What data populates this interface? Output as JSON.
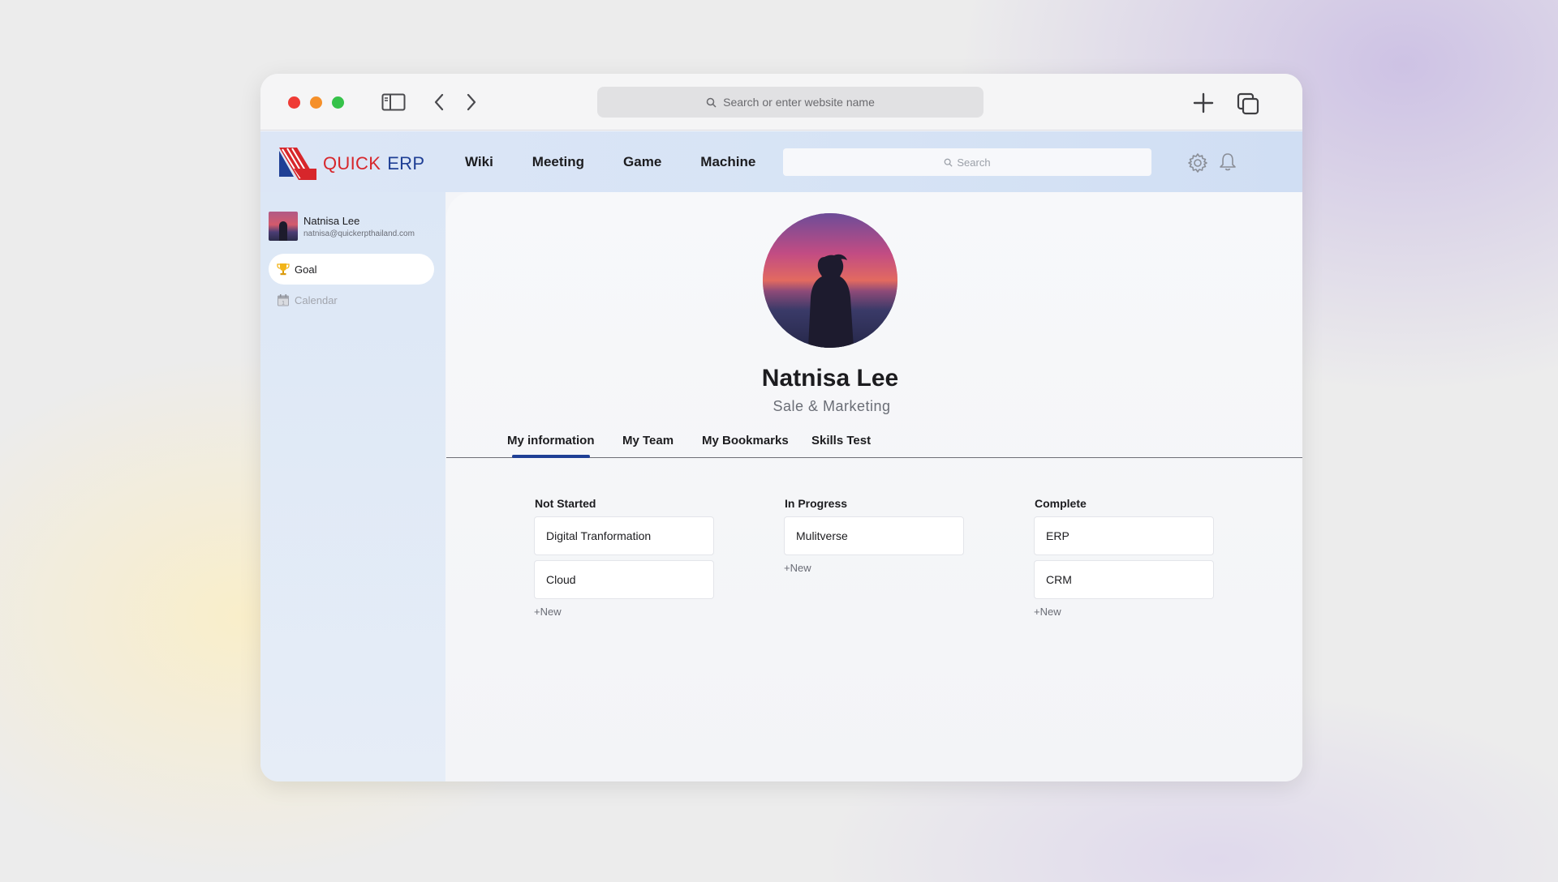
{
  "browser": {
    "address_placeholder": "Search or enter website name"
  },
  "app": {
    "logo_quick": "QUICK",
    "logo_erp": "ERP",
    "nav": [
      "Wiki",
      "Meeting",
      "Game",
      "Machine"
    ],
    "search_placeholder": "Search",
    "colors": {
      "brand_red": "#d7262b",
      "brand_blue": "#1f3f95"
    }
  },
  "sidebar": {
    "user_name": "Natnisa Lee",
    "user_email": "natnisa@quickerpthailand.com",
    "items": [
      {
        "label": "Goal",
        "icon": "trophy-icon",
        "active": true
      },
      {
        "label": "Calendar",
        "icon": "calendar-icon",
        "active": false
      }
    ]
  },
  "profile": {
    "name": "Natnisa Lee",
    "role": "Sale & Marketing",
    "tabs": [
      "My information",
      "My Team",
      "My Bookmarks",
      "Skills Test"
    ],
    "active_tab": "My information"
  },
  "board": {
    "columns": [
      {
        "title": "Not Started",
        "cards": [
          "Digital Tranformation",
          "Cloud"
        ],
        "new_label": "+New"
      },
      {
        "title": "In Progress",
        "cards": [
          "Mulitverse"
        ],
        "new_label": "+New"
      },
      {
        "title": "Complete",
        "cards": [
          "ERP",
          "CRM"
        ],
        "new_label": "+New"
      }
    ]
  }
}
